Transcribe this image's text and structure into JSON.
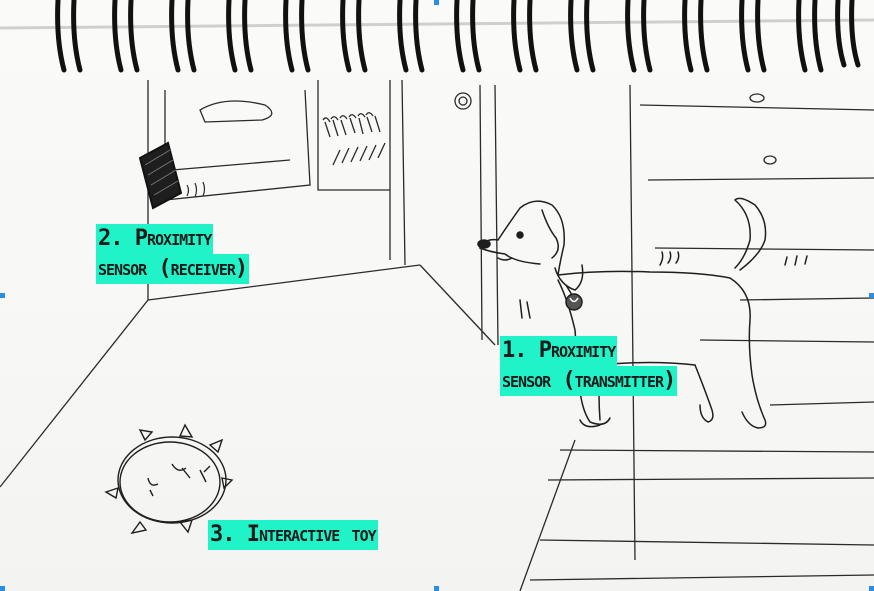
{
  "colors": {
    "highlight": "#21f3c8",
    "ink": "#1a1a1a",
    "paper": "#f7f7f5",
    "selection_handle": "#2b8de8"
  },
  "labels": {
    "receiver": {
      "line1": "2. Proximity",
      "line2": "sensor (receiver)"
    },
    "transmitter": {
      "line1": "1. Proximity",
      "line2": "sensor (transmitter)"
    },
    "toy": {
      "line1": "3. Interactive toy"
    }
  },
  "icons": [
    "spiral-binding-icon",
    "dog-sketch",
    "receiver-sketch",
    "toy-ball-sketch",
    "collar-tag-icon"
  ]
}
